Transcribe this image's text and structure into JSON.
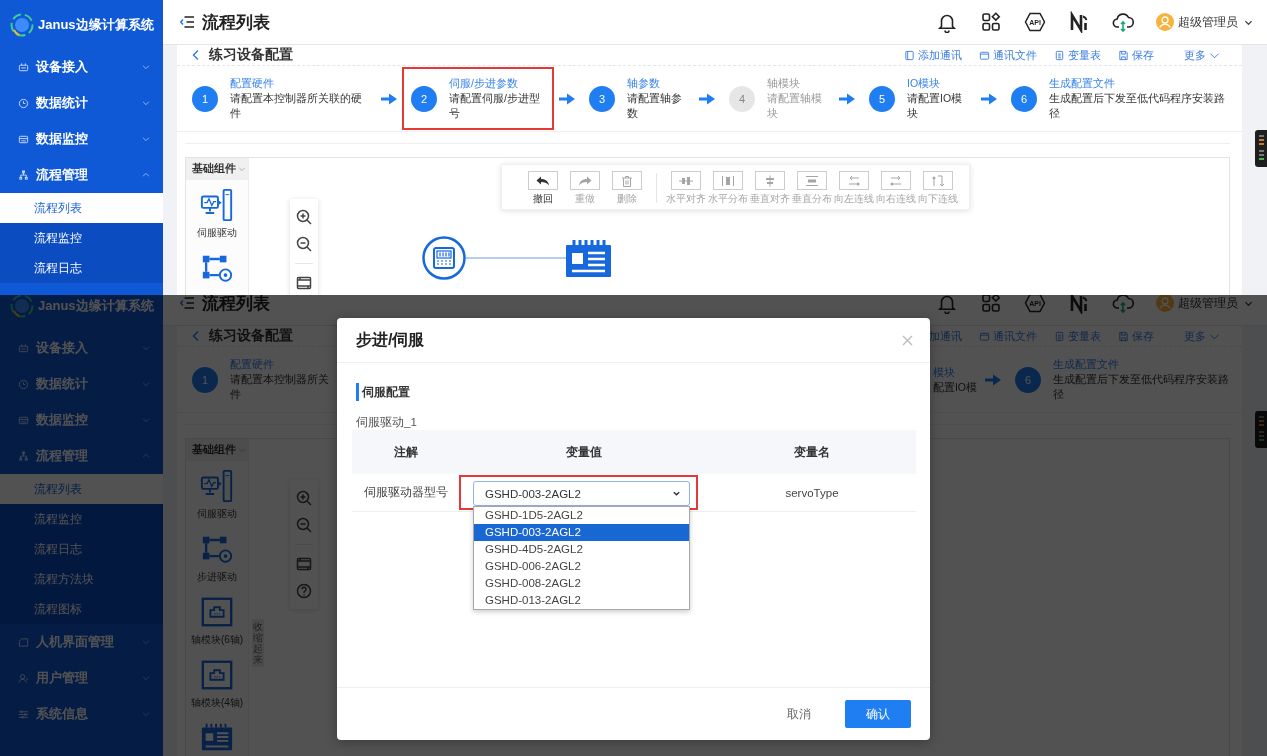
{
  "top_view": {
    "app_name": "Janus边缘计算系统",
    "sidebar": [
      {
        "label": "设备接入",
        "kind": "device",
        "expanded": false
      },
      {
        "label": "数据统计",
        "kind": "stats",
        "expanded": false
      },
      {
        "label": "数据监控",
        "kind": "monitor",
        "expanded": false
      },
      {
        "label": "流程管理",
        "kind": "flow",
        "expanded": true,
        "children": [
          {
            "label": "流程列表",
            "selected": true
          },
          {
            "label": "流程监控",
            "selected": false
          },
          {
            "label": "流程日志",
            "selected": false
          }
        ]
      }
    ],
    "header": {
      "title": "流程列表",
      "api_label": "API",
      "user": "超级管理员"
    },
    "page": {
      "title": "练习设备配置",
      "actions": [
        {
          "label": "添加通讯",
          "kind": "add"
        },
        {
          "label": "通讯文件",
          "kind": "file"
        },
        {
          "label": "变量表",
          "kind": "table"
        },
        {
          "label": "保存",
          "kind": "save"
        }
      ],
      "more": "更多"
    },
    "steps": [
      {
        "number": "1",
        "title": "配置硬件",
        "description": "请配置本控制器所关联的硬件",
        "disabled": false,
        "highlighted": false
      },
      {
        "number": "2",
        "title": "伺服/步进参数",
        "description": "请配置伺服/步进型号",
        "disabled": false,
        "highlighted": true
      },
      {
        "number": "3",
        "title": "轴参数",
        "description": "请配置轴参数",
        "disabled": false,
        "highlighted": false
      },
      {
        "number": "4",
        "title": "轴模块",
        "description": "请配置轴模块",
        "disabled": true,
        "highlighted": false
      },
      {
        "number": "5",
        "title": "IO模块",
        "description": "请配置IO模块",
        "disabled": false,
        "highlighted": false
      },
      {
        "number": "6",
        "title": "生成配置文件",
        "description": "生成配置后下发至低代码程序安装路径",
        "disabled": false,
        "highlighted": false
      }
    ],
    "palette": {
      "title": "基础组件",
      "items": [
        {
          "label": "伺服驱动",
          "kind": "servo"
        },
        {
          "kind": "stepper"
        }
      ]
    },
    "zoom_tools": [
      {
        "kind": "zoom-in"
      },
      {
        "kind": "zoom-out"
      },
      {
        "kind": "fit"
      }
    ],
    "edit_toolbar": [
      [
        {
          "label": "撤回",
          "kind": "undo",
          "disabled": false
        },
        {
          "label": "重做",
          "kind": "redo",
          "disabled": true
        },
        {
          "label": "删除",
          "kind": "delete",
          "disabled": true
        }
      ],
      [
        {
          "label": "水平对齐",
          "kind": "align-h",
          "disabled": true
        },
        {
          "label": "水平分布",
          "kind": "distribute-h",
          "disabled": true
        },
        {
          "label": "垂直对齐",
          "kind": "align-v",
          "disabled": true
        },
        {
          "label": "垂直分布",
          "kind": "distribute-v",
          "disabled": true
        },
        {
          "label": "向左连线",
          "kind": "link-left",
          "disabled": true
        },
        {
          "label": "向右连线",
          "kind": "link-right",
          "disabled": true
        },
        {
          "label": "向下连线",
          "kind": "link-down",
          "disabled": true
        }
      ]
    ],
    "nodes": [
      {
        "kind": "controller"
      },
      {
        "kind": "io-module"
      }
    ]
  },
  "bottom_view": {
    "app_name": "Janus边缘计算系统",
    "sidebar": [
      {
        "label": "设备接入",
        "kind": "device",
        "expanded": false
      },
      {
        "label": "数据统计",
        "kind": "stats",
        "expanded": false
      },
      {
        "label": "数据监控",
        "kind": "monitor",
        "expanded": false
      },
      {
        "label": "流程管理",
        "kind": "flow",
        "expanded": true,
        "children": [
          {
            "label": "流程列表",
            "selected": true
          },
          {
            "label": "流程监控",
            "selected": false
          },
          {
            "label": "流程日志",
            "selected": false
          },
          {
            "label": "流程方法块",
            "selected": false
          },
          {
            "label": "流程图标",
            "selected": false
          }
        ]
      },
      {
        "label": "人机界面管理",
        "kind": "hmi",
        "expanded": false
      },
      {
        "label": "用户管理",
        "kind": "users",
        "expanded": false
      },
      {
        "label": "系统信息",
        "kind": "system",
        "expanded": false
      }
    ],
    "header": {
      "title": "流程列表",
      "api_label": "API",
      "user": "超级管理员"
    },
    "page": {
      "title": "练习设备配置",
      "actions": [
        {
          "label": "加通讯"
        },
        {
          "label": "通讯文件",
          "kind": "file"
        },
        {
          "label": "变量表",
          "kind": "table"
        },
        {
          "label": "保存",
          "kind": "save"
        }
      ],
      "more": "更多"
    },
    "steps_left": [
      {
        "number": "1",
        "title": "配置硬件",
        "description_lines": [
          "请配置本控制器所关",
          "件"
        ],
        "disabled": false,
        "highlighted": false
      }
    ],
    "steps_right": [
      {
        "title": "模块",
        "description_lines": [
          "配置IO模"
        ],
        "disabled": false,
        "highlighted": false
      },
      {
        "number": "6",
        "title": "生成配置文件",
        "description": "生成配置后下发至低代码程序安装路径",
        "disabled": false,
        "highlighted": false
      }
    ],
    "palette": {
      "title": "基础组件",
      "items": [
        {
          "label": "伺服驱动",
          "kind": "servo"
        },
        {
          "label": "步进驱动",
          "kind": "stepper"
        },
        {
          "label": "轴模块(6轴)",
          "kind": "axis"
        },
        {
          "label": "轴模块(4轴)",
          "kind": "axis"
        },
        {
          "kind": "io"
        }
      ]
    },
    "collapse_label": "收缩起来",
    "zoom_tools": [
      {
        "kind": "zoom-in"
      },
      {
        "kind": "zoom-out"
      },
      {
        "kind": "fit"
      },
      {
        "kind": "help"
      }
    ],
    "dialog": {
      "title": "步进/伺服",
      "section": "伺服配置",
      "group": "伺服驱动_1",
      "columns": [
        "注解",
        "变量值",
        "变量名"
      ],
      "rows": [
        {
          "note": "伺服驱动器型号",
          "value": "GSHD-003-2AGL2",
          "name": "servoType",
          "highlighted": true,
          "open": true,
          "options": [
            {
              "label": "GSHD-1D5-2AGL2",
              "selected": false
            },
            {
              "label": "GSHD-003-2AGL2",
              "selected": true
            },
            {
              "label": "GSHD-4D5-2AGL2",
              "selected": false
            },
            {
              "label": "GSHD-006-2AGL2",
              "selected": false
            },
            {
              "label": "GSHD-008-2AGL2",
              "selected": false
            },
            {
              "label": "GSHD-013-2AGL2",
              "selected": false
            }
          ]
        }
      ],
      "buttons": [
        {
          "label": "取消",
          "kind": "text"
        },
        {
          "label": "确认",
          "kind": "primary"
        }
      ]
    }
  }
}
